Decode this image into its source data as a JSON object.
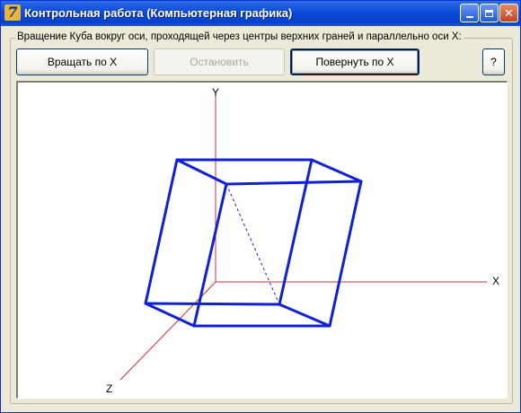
{
  "window": {
    "title": "Контрольная работа (Компьютерная графика)",
    "app_icon_glyph": "7"
  },
  "group": {
    "caption": "Вращение Куба вокруг оси, проходящей через центры верхних граней и параллельно оси X:"
  },
  "buttons": {
    "rotate_label": "Вращать по X",
    "stop_label": "Остановить",
    "turn_label": "Повернуть по X",
    "help_label": "?"
  },
  "axes": {
    "y_label": "Y",
    "x_label": "X",
    "z_label": "Z"
  },
  "colors": {
    "titlebar": "#0a48d8",
    "cube_edges": "#1020d8",
    "axes": "#c8303a"
  }
}
